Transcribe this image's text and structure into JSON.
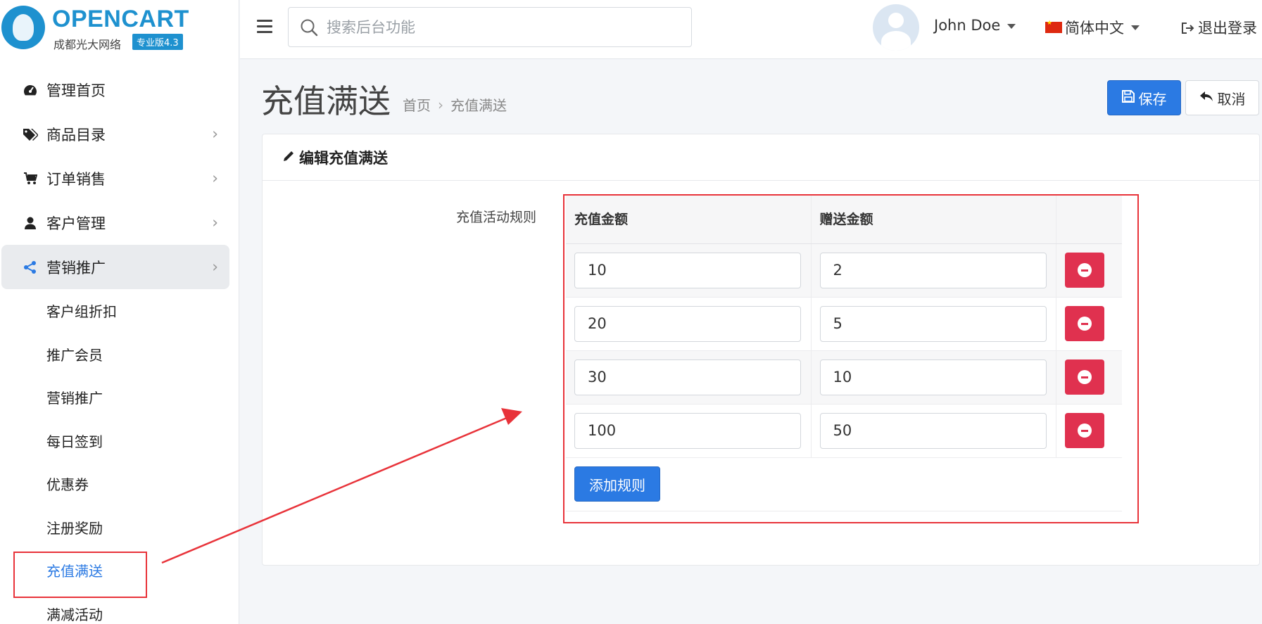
{
  "brand": {
    "title": "OPENCART",
    "subtitle": "成都光大网络",
    "badge": "专业版4.3"
  },
  "header": {
    "search_placeholder": "搜索后台功能",
    "user_name": "John Doe",
    "language": "简体中文",
    "logout": "退出登录"
  },
  "sidebar": {
    "items": [
      {
        "label": "管理首页",
        "icon": "dashboard-icon"
      },
      {
        "label": "商品目录",
        "icon": "tags-icon"
      },
      {
        "label": "订单销售",
        "icon": "cart-icon"
      },
      {
        "label": "客户管理",
        "icon": "user-icon"
      },
      {
        "label": "营销推广",
        "icon": "share-icon"
      }
    ],
    "sub_items": [
      "客户组折扣",
      "推广会员",
      "营销推广",
      "每日签到",
      "优惠券",
      "注册奖励",
      "充值满送",
      "满减活动"
    ]
  },
  "page": {
    "title": "充值满送",
    "breadcrumb": [
      "首页",
      "充值满送"
    ],
    "save_label": "保存",
    "cancel_label": "取消"
  },
  "form": {
    "card_title": "编辑充值满送",
    "field_label": "充值活动规则",
    "columns": [
      "充值金额",
      "赠送金额"
    ],
    "rules": [
      {
        "amount": "10",
        "bonus": "2"
      },
      {
        "amount": "20",
        "bonus": "5"
      },
      {
        "amount": "30",
        "bonus": "10"
      },
      {
        "amount": "100",
        "bonus": "50"
      }
    ],
    "add_label": "添加规则"
  },
  "colors": {
    "primary": "#2b7ae3",
    "danger": "#e0314f",
    "annotation": "#e8333a"
  }
}
